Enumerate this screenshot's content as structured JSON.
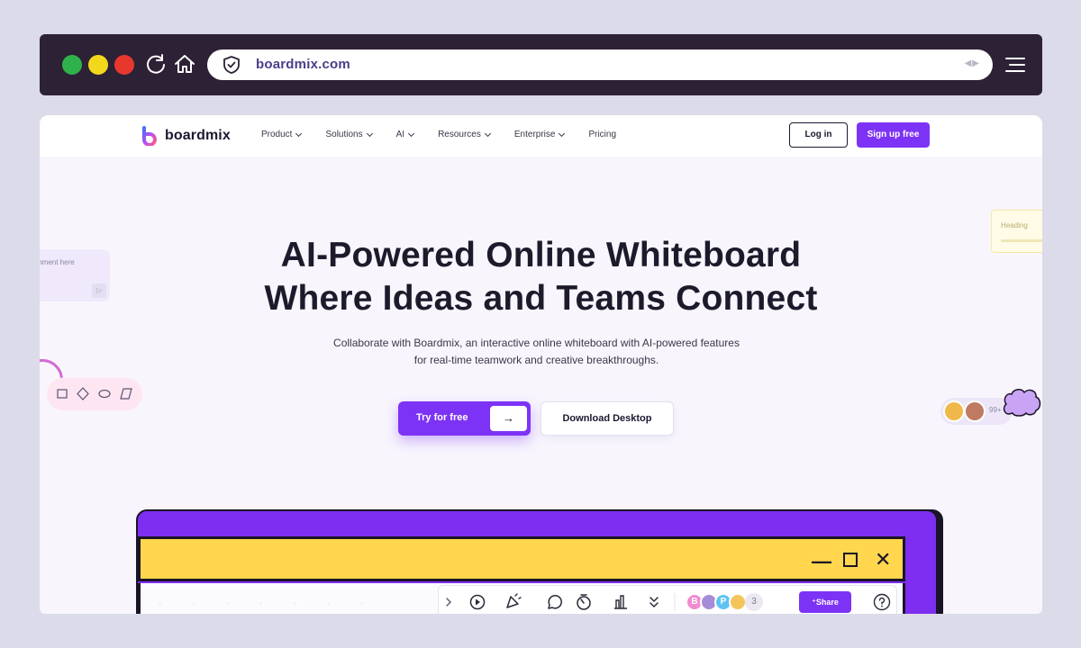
{
  "browser": {
    "url": "boardmix.com",
    "traffic_lights": {
      "green": "#2fb24b",
      "yellow": "#f3d71c",
      "red": "#e8382d"
    }
  },
  "nav": {
    "logo_text": "boardmix",
    "items": [
      {
        "label": "Product",
        "has_dropdown": true
      },
      {
        "label": "Solutions",
        "has_dropdown": true
      },
      {
        "label": "AI",
        "has_dropdown": true
      },
      {
        "label": "Resources",
        "has_dropdown": true
      },
      {
        "label": "Enterprise",
        "has_dropdown": true
      },
      {
        "label": "Pricing",
        "has_dropdown": false
      }
    ],
    "login_label": "Log in",
    "signup_label": "Sign up free"
  },
  "hero": {
    "headline_line1": "AI-Powered Online Whiteboard",
    "headline_line2": "Where Ideas and Teams Connect",
    "subtitle_line1": "Collaborate with Boardmix, an interactive online whiteboard with AI-powered features",
    "subtitle_line2": "for real-time teamwork and creative breakthroughs.",
    "try_label": "Try for free",
    "download_label": "Download Desktop"
  },
  "decor": {
    "comment_placeholder": "mment here",
    "heading_card": "Heading",
    "avatar_count": "99+"
  },
  "mockup": {
    "collaborator_initials": [
      "B",
      "P"
    ],
    "collaborator_count": "3",
    "share_label": "Share"
  },
  "colors": {
    "brand": "#7d33f5",
    "dark": "#1c1830",
    "window_yellow": "#ffd64d"
  }
}
